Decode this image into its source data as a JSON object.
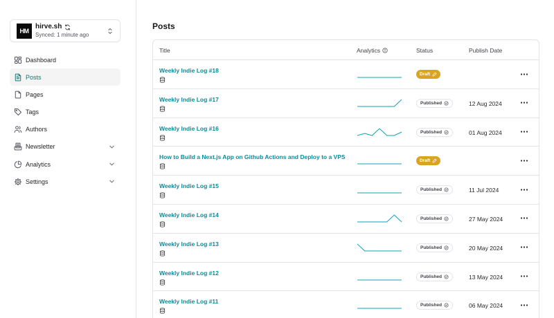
{
  "site": {
    "logo_text": "HM",
    "name": "hirve.sh",
    "sync_status": "Synced: 1 minute ago"
  },
  "nav": [
    {
      "label": "Dashboard",
      "icon": "dashboard-icon",
      "active": false,
      "expandable": false
    },
    {
      "label": "Posts",
      "icon": "file-text-icon",
      "active": true,
      "expandable": false
    },
    {
      "label": "Pages",
      "icon": "file-icon",
      "active": false,
      "expandable": false
    },
    {
      "label": "Tags",
      "icon": "tag-icon",
      "active": false,
      "expandable": false
    },
    {
      "label": "Authors",
      "icon": "users-icon",
      "active": false,
      "expandable": false
    },
    {
      "label": "Newsletter",
      "icon": "newsletter-icon",
      "active": false,
      "expandable": true
    },
    {
      "label": "Analytics",
      "icon": "pie-chart-icon",
      "active": false,
      "expandable": true
    },
    {
      "label": "Settings",
      "icon": "gear-icon",
      "active": false,
      "expandable": true
    }
  ],
  "page": {
    "title": "Posts"
  },
  "table": {
    "headers": {
      "title": "Title",
      "analytics": "Analytics",
      "status": "Status",
      "date": "Publish Date"
    },
    "rows": [
      {
        "title": "Weekly Indie Log #18",
        "status": "Draft",
        "date": "",
        "trend": [
          0,
          0,
          0,
          0,
          0,
          0,
          0
        ]
      },
      {
        "title": "Weekly Indie Log #17",
        "status": "Published",
        "date": "12 Aug 2024",
        "trend": [
          0,
          0,
          0,
          0,
          0,
          0,
          1
        ]
      },
      {
        "title": "Weekly Indie Log #16",
        "status": "Published",
        "date": "01 Aug 2024",
        "trend": [
          0,
          0.3,
          0,
          1,
          0,
          0,
          0.5
        ]
      },
      {
        "title": "How to Build a Next.js App on Github Actions and Deploy to a VPS",
        "status": "Draft",
        "date": "",
        "trend": [
          0,
          0,
          0,
          0,
          0,
          0,
          0
        ]
      },
      {
        "title": "Weekly Indie Log #15",
        "status": "Published",
        "date": "11 Jul 2024",
        "trend": [
          0,
          0,
          0,
          0,
          0,
          0,
          0
        ]
      },
      {
        "title": "Weekly Indie Log #14",
        "status": "Published",
        "date": "27 May 2024",
        "trend": [
          0,
          0,
          0,
          0,
          0,
          1,
          0
        ]
      },
      {
        "title": "Weekly Indie Log #13",
        "status": "Published",
        "date": "20 May 2024",
        "trend": [
          1,
          0,
          0,
          0,
          0,
          0,
          0
        ]
      },
      {
        "title": "Weekly Indie Log #12",
        "status": "Published",
        "date": "13 May 2024",
        "trend": [
          0,
          0,
          0,
          0,
          0,
          0,
          0
        ]
      },
      {
        "title": "Weekly Indie Log #11",
        "status": "Published",
        "date": "06 May 2024",
        "trend": [
          0,
          0,
          0,
          0,
          0,
          0,
          0
        ]
      }
    ]
  },
  "colors": {
    "accent": "#0e8a9a",
    "spark": "#0ea5b7",
    "draft": "#d9a520",
    "border": "#e4e4e7"
  }
}
